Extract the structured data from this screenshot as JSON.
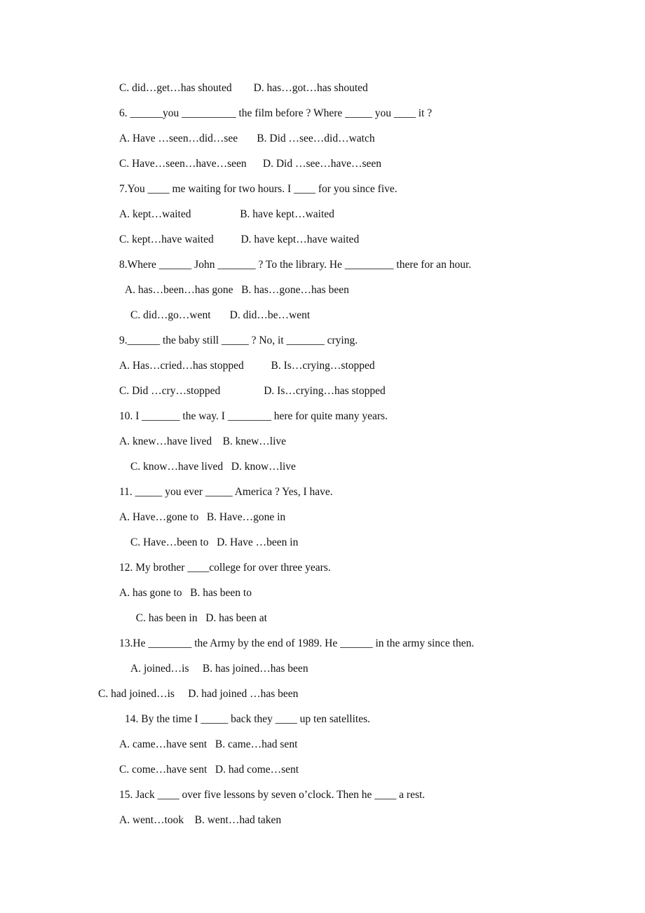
{
  "document": {
    "type": "english-grammar-worksheet",
    "background_color": "#ffffff",
    "text_color": "#111111",
    "lines": [
      {
        "id": "q5-opt-cd",
        "indent": "base",
        "text": "C. did…get…has shouted        D. has…got…has shouted"
      },
      {
        "id": "q6-stem",
        "indent": "base",
        "text": "6. ______you __________ the film before ? Where _____ you ____ it ?"
      },
      {
        "id": "q6-opt-ab",
        "indent": "base",
        "text": "A. Have …seen…did…see       B. Did …see…did…watch"
      },
      {
        "id": "q6-opt-cd",
        "indent": "base",
        "text": "C. Have…seen…have…seen      D. Did …see…have…seen"
      },
      {
        "id": "q7-stem",
        "indent": "base",
        "text": "7.You ____ me waiting for two hours. I ____ for you since five."
      },
      {
        "id": "q7-opt-ab",
        "indent": "base",
        "text": "A. kept…waited                  B. have kept…waited"
      },
      {
        "id": "q7-opt-cd",
        "indent": "base",
        "text": "C. kept…have waited          D. have kept…have waited"
      },
      {
        "id": "q8-stem",
        "indent": "base",
        "text": "8.Where ______ John _______ ? To the library. He _________ there for an hour."
      },
      {
        "id": "q8-opt-ab",
        "indent": "plus",
        "text": "A. has…been…has gone   B. has…gone…has been"
      },
      {
        "id": "q8-opt-cd",
        "indent": "plus2",
        "text": "C. did…go…went       D. did…be…went"
      },
      {
        "id": "q9-stem",
        "indent": "base",
        "text": "9.______ the baby still _____ ? No, it _______ crying."
      },
      {
        "id": "q9-opt-ab",
        "indent": "base",
        "text": "A. Has…cried…has stopped          B. Is…crying…stopped"
      },
      {
        "id": "q9-opt-cd",
        "indent": "base",
        "text": "C. Did …cry…stopped                D. Is…crying…has stopped"
      },
      {
        "id": "q10-stem",
        "indent": "base",
        "text": "10. I _______ the way. I ________ here for quite many years."
      },
      {
        "id": "q10-opt-ab",
        "indent": "base",
        "text": "A. knew…have lived    B. knew…live"
      },
      {
        "id": "q10-opt-cd",
        "indent": "plus2",
        "text": "C. know…have lived   D. know…live"
      },
      {
        "id": "q11-stem",
        "indent": "base",
        "text": "11. _____ you ever _____ America ? Yes, I have."
      },
      {
        "id": "q11-opt-ab",
        "indent": "base",
        "text": "A. Have…gone to   B. Have…gone in"
      },
      {
        "id": "q11-opt-cd",
        "indent": "plus2",
        "text": "C. Have…been to   D. Have …been in"
      },
      {
        "id": "q12-stem",
        "indent": "base",
        "text": "12. My brother ____college for over three years."
      },
      {
        "id": "q12-opt-ab",
        "indent": "base",
        "text": "A. has gone to   B. has been to"
      },
      {
        "id": "q12-opt-cd",
        "indent": "plus2",
        "text": "  C. has been in   D. has been at"
      },
      {
        "id": "q13-stem",
        "indent": "base",
        "text": "13.He ________ the Army by the end of 1989. He ______ in the army since then."
      },
      {
        "id": "q13-opt-ab",
        "indent": "plus2",
        "text": "A. joined…is     B. has joined…has been"
      },
      {
        "id": "q13-opt-cd",
        "indent": "out",
        "text": "C. had joined…is     D. had joined …has been"
      },
      {
        "id": "q14-stem",
        "indent": "plus",
        "text": "14. By the time I _____ back they ____ up ten satellites."
      },
      {
        "id": "q14-opt-ab",
        "indent": "base",
        "text": "A. came…have sent   B. came…had sent"
      },
      {
        "id": "q14-opt-cd",
        "indent": "base",
        "text": "C. come…have sent   D. had come…sent"
      },
      {
        "id": "q15-stem",
        "indent": "base",
        "text": "15. Jack ____ over five lessons by seven o’clock. Then he ____ a rest."
      },
      {
        "id": "q15-opt-ab",
        "indent": "base",
        "text": "A. went…took    B. went…had taken"
      }
    ]
  }
}
